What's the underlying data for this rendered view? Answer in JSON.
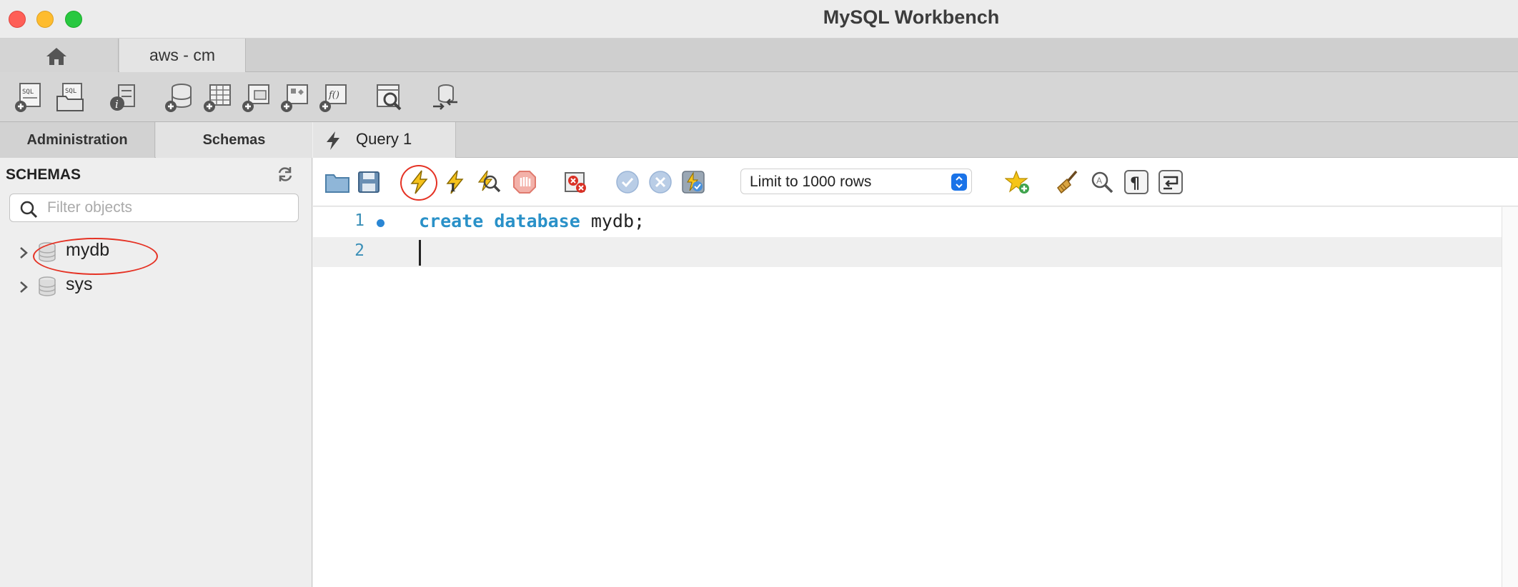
{
  "window": {
    "title": "MySQL Workbench"
  },
  "connection_tabs": [
    {
      "label": "aws - cm"
    }
  ],
  "sidebar": {
    "tabs": [
      {
        "label": "Administration"
      },
      {
        "label": "Schemas"
      }
    ],
    "header": "SCHEMAS",
    "search": {
      "placeholder": "Filter objects",
      "value": ""
    },
    "schemas": [
      {
        "name": "mydb"
      },
      {
        "name": "sys"
      }
    ]
  },
  "query_tabs": [
    {
      "label": "Query 1"
    }
  ],
  "sql_toolbar": {
    "limit": "Limit to 1000 rows"
  },
  "editor": {
    "lines": [
      {
        "number": "1",
        "keywords": "create database",
        "rest": " mydb;"
      },
      {
        "number": "2",
        "text": ""
      }
    ]
  },
  "icons": {
    "main_toolbar": [
      "new-sql-tab-icon",
      "open-sql-script-icon",
      "server-info-icon",
      "create-schema-icon",
      "create-table-icon",
      "create-view-icon",
      "create-procedure-icon",
      "create-function-icon",
      "search-table-data-icon",
      "reconnect-icon"
    ],
    "sql_toolbar": [
      "open-file-icon",
      "save-file-icon",
      "execute-icon",
      "execute-current-statement-icon",
      "explain-icon",
      "stop-icon",
      "toggle-continue-on-error-icon",
      "commit-icon",
      "rollback-icon",
      "autocommit-icon",
      "add-snippet-icon",
      "beautify-icon",
      "find-icon",
      "invisible-characters-icon",
      "word-wrap-icon"
    ]
  },
  "colors": {
    "keyword": "#2a91c8",
    "highlight_ring": "#e53224",
    "close": "#fe5f57",
    "minimize": "#febc2e",
    "maximize": "#28c840"
  }
}
